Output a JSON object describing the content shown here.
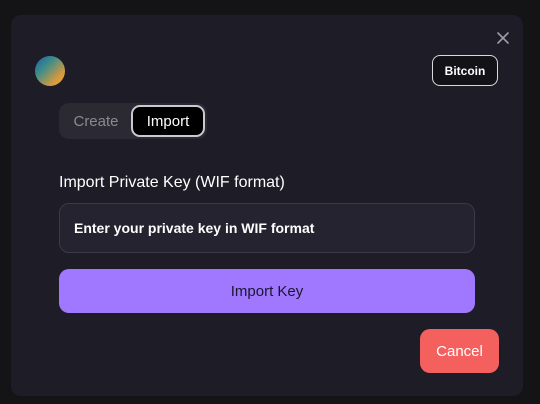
{
  "modal": {
    "close_icon": "close-icon",
    "network_button_label": "Bitcoin",
    "avatar_icon": "gradient-avatar"
  },
  "tabs": [
    {
      "label": "Create",
      "active": false
    },
    {
      "label": "Import",
      "active": true
    }
  ],
  "import_form": {
    "field_label": "Import Private Key (WIF format)",
    "input_placeholder": "Enter your private key in WIF format",
    "input_value": "",
    "submit_label": "Import Key"
  },
  "footer": {
    "cancel_label": "Cancel"
  },
  "colors": {
    "backdrop": "#141416",
    "modal_bg": "#1e1d27",
    "primary": "#a078ff",
    "danger": "#f3605e"
  }
}
